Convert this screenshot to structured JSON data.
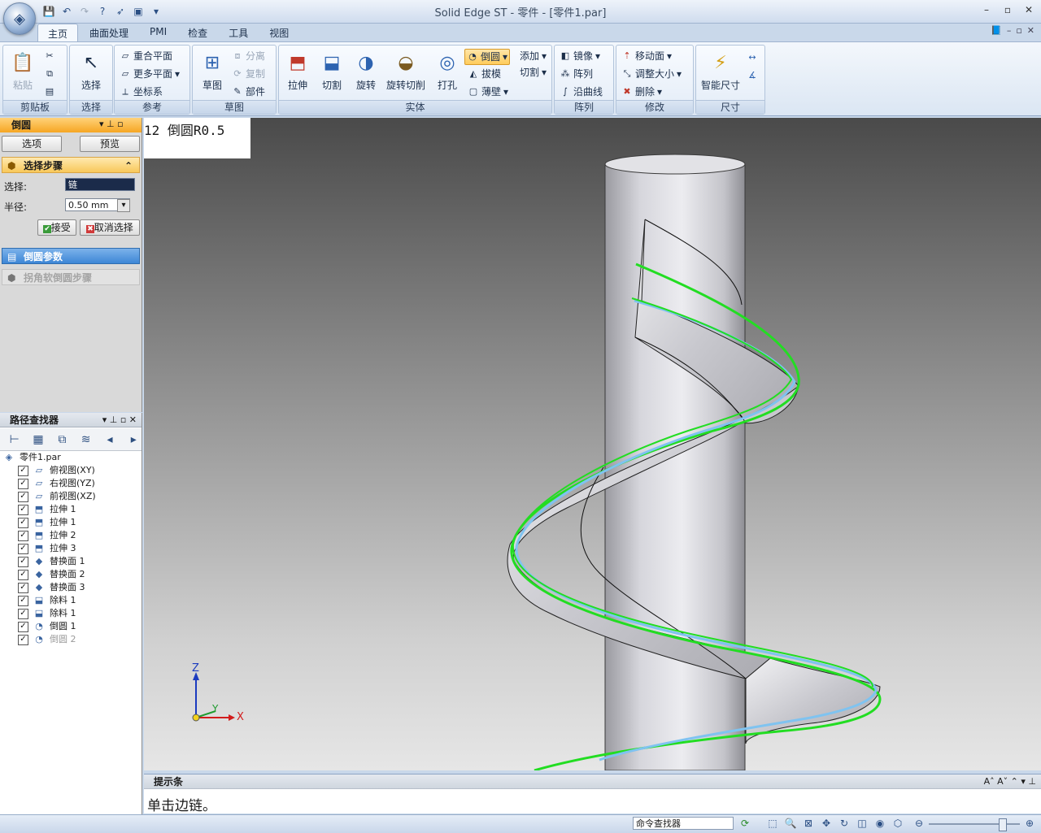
{
  "window": {
    "title": "Solid Edge ST - 零件 - [零件1.par]",
    "controls": [
      "–",
      "▫",
      "✕"
    ]
  },
  "qat": {
    "icons": [
      "save-icon",
      "undo-icon",
      "redo-icon",
      "help-icon",
      "pointer-icon",
      "part-icon",
      "dropdown-icon"
    ]
  },
  "tabs": [
    {
      "label": "主页",
      "active": true
    },
    {
      "label": "曲面处理"
    },
    {
      "label": "PMI"
    },
    {
      "label": "检查"
    },
    {
      "label": "工具"
    },
    {
      "label": "视图"
    }
  ],
  "ribbon": {
    "clipboard": {
      "label": "剪贴板",
      "paste": "粘贴"
    },
    "select": {
      "label": "选择",
      "select": "选择"
    },
    "reference": {
      "label": "参考",
      "coincident_plane": "重合平面",
      "more_planes": "更多平面",
      "coordinate_system": "坐标系"
    },
    "sketch": {
      "label": "草图",
      "sketch": "草图",
      "separate": "分离",
      "copy": "复制",
      "part": "部件"
    },
    "solids": {
      "label": "实体",
      "extrude": "拉伸",
      "cut": "切割",
      "revolve": "旋转",
      "revolve_cut": "旋转切削",
      "hole": "打孔",
      "round": "倒圆",
      "draft": "拔模",
      "thin_wall": "薄壁",
      "add": "添加",
      "cut_menu": "切割"
    },
    "pattern": {
      "label": "阵列",
      "mirror": "镜像",
      "pattern": "阵列",
      "along_curve": "沿曲线"
    },
    "modify": {
      "label": "修改",
      "move_faces": "移动面",
      "resize": "调整大小",
      "delete": "删除"
    },
    "dimension": {
      "label": "尺寸",
      "smart_dimension": "智能尺寸"
    }
  },
  "fillet_panel": {
    "title": "倒圆",
    "options_button": "选项",
    "preview_button": "预览",
    "select_step": "选择步骤",
    "select_label": "选择:",
    "select_value": "链",
    "radius_label": "半径:",
    "radius_value": "0.50 mm",
    "accept_button": "接受",
    "deselect_button": "取消选择",
    "params_step": "倒圆参数",
    "soft_corner_step": "拐角软倒圆步骤"
  },
  "pathfinder": {
    "title": "路径查找器",
    "root": "零件1.par",
    "items": [
      {
        "label": "俯视图(XY)",
        "icon": "plane-icon",
        "checked": true
      },
      {
        "label": "右视图(YZ)",
        "icon": "plane-icon",
        "checked": true
      },
      {
        "label": "前视图(XZ)",
        "icon": "plane-icon",
        "checked": true
      },
      {
        "label": "拉伸 1",
        "icon": "extrude-icon",
        "checked": true
      },
      {
        "label": "拉伸 1",
        "icon": "extrude-icon",
        "checked": true
      },
      {
        "label": "拉伸 2",
        "icon": "extrude-icon",
        "checked": true
      },
      {
        "label": "拉伸 3",
        "icon": "extrude-icon",
        "checked": true
      },
      {
        "label": "替换面 1",
        "icon": "replace-face-icon",
        "checked": true
      },
      {
        "label": "替换面 2",
        "icon": "replace-face-icon",
        "checked": true
      },
      {
        "label": "替换面 3",
        "icon": "replace-face-icon",
        "checked": true
      },
      {
        "label": "除料 1",
        "icon": "cutout-icon",
        "checked": true
      },
      {
        "label": "除料 1",
        "icon": "cutout-icon",
        "checked": true
      },
      {
        "label": "倒圆 1",
        "icon": "round-icon",
        "checked": true
      },
      {
        "label": "倒圆 2",
        "icon": "round-icon",
        "checked": true,
        "dim": true
      }
    ]
  },
  "viewport": {
    "step_label": "12 倒圆R0.5",
    "axes": {
      "z": "Z",
      "y": "Y",
      "x": "X"
    },
    "colors": {
      "helix_edge": "#22dd22",
      "highlight": "#7fc3f0"
    }
  },
  "promptbar": {
    "title": "提示条",
    "message": "单击边链。"
  },
  "statusbar": {
    "command_finder": "命令查找器"
  }
}
